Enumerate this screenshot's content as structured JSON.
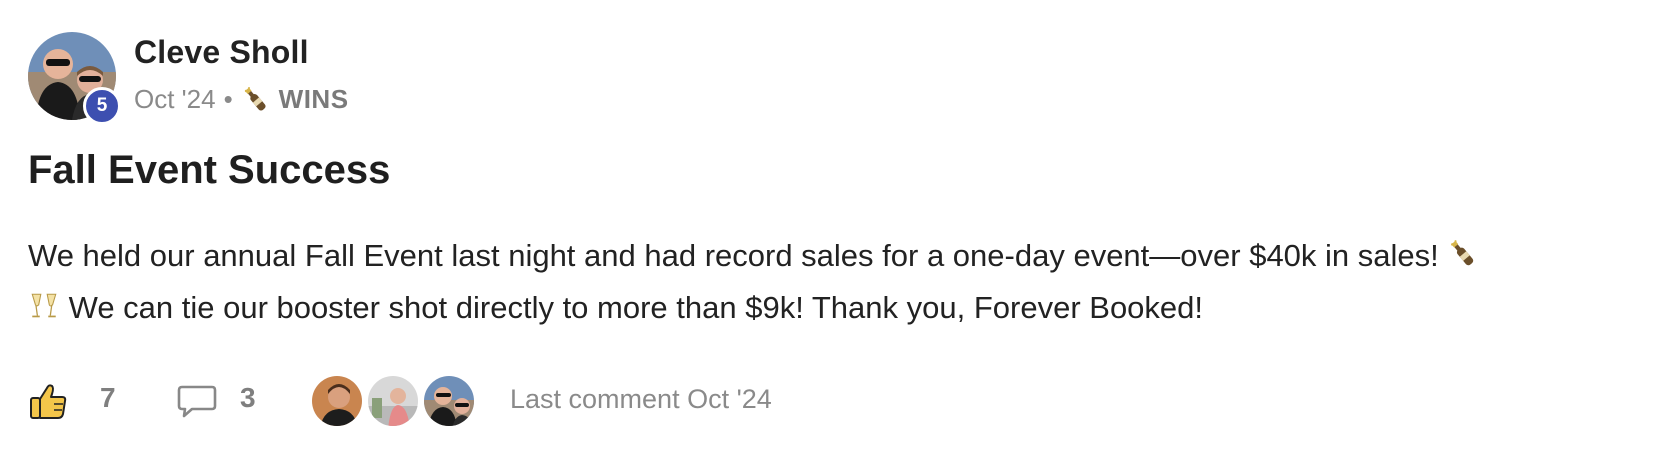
{
  "post": {
    "author": "Cleve Sholl",
    "level_badge": "5",
    "date": "Oct '24",
    "separator": "•",
    "category_icon": "champagne-bottle-icon",
    "category": "WINS",
    "title": "Fall Event Success",
    "body_line1": "We held our annual Fall Event last night and had record sales for a one-day event—over $40k in sales!",
    "body_line2": "We can tie our booster shot directly to more than $9k! Thank you, Forever Booked!",
    "body_icons": [
      "champagne-bottle-icon",
      "clinking-glasses-icon"
    ]
  },
  "footer": {
    "like_icon": "thumbs-up-icon",
    "like_count": "7",
    "comment_icon": "comment-bubble-icon",
    "comment_count": "3",
    "participants": [
      "participant-avatar-1",
      "participant-avatar-2",
      "participant-avatar-3"
    ],
    "last_comment": "Last comment Oct '24"
  },
  "colors": {
    "badge": "#3d4fb0",
    "muted_text": "#8a8a8a",
    "primary_text": "#222222",
    "like_icon_fill": "#f4c64a"
  }
}
